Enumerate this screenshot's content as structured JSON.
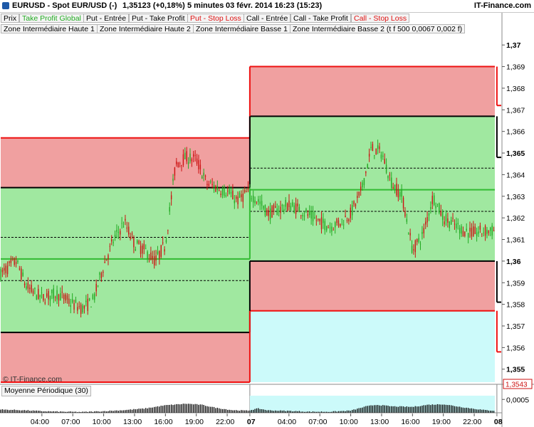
{
  "header": {
    "instrument": "EURUSD - Spot EUR/USD (-)",
    "quote": "1,35123 (+0,18%)",
    "period": "5 minutes",
    "datetime": "03 févr. 2014 16:23 (15:23)",
    "brand": "IT-Finance.com"
  },
  "legend": [
    {
      "label": "Prix",
      "color": "#000000"
    },
    {
      "label": "Take Profit Global",
      "color": "#22aa22"
    },
    {
      "label": "Put - Entrée",
      "color": "#000000"
    },
    {
      "label": "Put - Take Profit",
      "color": "#000000"
    },
    {
      "label": "Put - Stop Loss",
      "color": "#dd1111"
    },
    {
      "label": "Call - Entrée",
      "color": "#000000"
    },
    {
      "label": "Call - Take Profit",
      "color": "#000000"
    },
    {
      "label": "Call - Stop Loss",
      "color": "#dd1111"
    },
    {
      "label": "Zone Intermédiaire Haute 1",
      "color": "#000000"
    },
    {
      "label": "Zone Intermédiaire Haute 2",
      "color": "#000000"
    },
    {
      "label": "Zone Intermédiaire Basse 1",
      "color": "#000000"
    },
    {
      "label": "Zone Intermédiaire Basse 2 (t f 500 0,0067 0,002 f)",
      "color": "#000000"
    }
  ],
  "copyright": "© IT-Finance.com",
  "indicator": {
    "label": "Moyenne Périodique (30)"
  },
  "colors": {
    "candle_up": "#22aa22",
    "candle_down": "#cc1111",
    "zone_red": "#f0a0a0",
    "zone_green": "#a0e8a0",
    "zone_cyan": "#ccfafa",
    "stop_line": "#ee1111",
    "entry_line": "#000000",
    "tp_line": "#33bb33",
    "histogram": "#000000",
    "current_price_box": "#cc1111"
  },
  "chart_data": {
    "type": "line",
    "title": "",
    "xlabel": "",
    "ylabel": "",
    "ylim": [
      1.3543,
      1.3705
    ],
    "y_ticks": [
      "1,37",
      "1,369",
      "1,368",
      "1,367",
      "1,366",
      "1,365",
      "1,364",
      "1,363",
      "1,362",
      "1,361",
      "1,36",
      "1,359",
      "1,358",
      "1,357",
      "1,356",
      "1,355"
    ],
    "y_ticks_bold": [
      "1,37",
      "1,365",
      "1,36",
      "1,355"
    ],
    "y_tick_values": [
      1.37,
      1.369,
      1.368,
      1.367,
      1.366,
      1.365,
      1.364,
      1.363,
      1.362,
      1.361,
      1.36,
      1.359,
      1.358,
      1.357,
      1.356,
      1.355
    ],
    "current_price_label": "1,3543",
    "x_range": [
      0,
      48
    ],
    "x_ticks": [
      {
        "label": "04:00",
        "x": 4
      },
      {
        "label": "07:00",
        "x": 7
      },
      {
        "label": "10:00",
        "x": 10
      },
      {
        "label": "13:00",
        "x": 13
      },
      {
        "label": "16:00",
        "x": 16
      },
      {
        "label": "19:00",
        "x": 19
      },
      {
        "label": "22:00",
        "x": 22
      },
      {
        "label": "07",
        "x": 24.2,
        "bold": true
      },
      {
        "label": "04:00",
        "x": 28
      },
      {
        "label": "07:00",
        "x": 31
      },
      {
        "label": "10:00",
        "x": 34
      },
      {
        "label": "13:00",
        "x": 37
      },
      {
        "label": "16:00",
        "x": 40
      },
      {
        "label": "19:00",
        "x": 43
      },
      {
        "label": "22:00",
        "x": 46
      },
      {
        "label": "08",
        "x": 48.2,
        "bold": true
      }
    ],
    "zones": [
      {
        "x": [
          0,
          24.2
        ],
        "y": [
          1.3657,
          1.3634
        ],
        "color": "red"
      },
      {
        "x": [
          0,
          24.2
        ],
        "y": [
          1.3634,
          1.3567
        ],
        "color": "green"
      },
      {
        "x": [
          0,
          24.2
        ],
        "y": [
          1.3567,
          1.3544
        ],
        "color": "red"
      },
      {
        "x": [
          24.2,
          48.2
        ],
        "y": [
          1.369,
          1.3667
        ],
        "color": "red"
      },
      {
        "x": [
          24.2,
          48.2
        ],
        "y": [
          1.3667,
          1.36
        ],
        "color": "green"
      },
      {
        "x": [
          24.2,
          48.2
        ],
        "y": [
          1.36,
          1.3577
        ],
        "color": "red"
      },
      {
        "x": [
          24.2,
          48.2
        ],
        "y": [
          1.3577,
          1.3544
        ],
        "color": "cyan"
      }
    ],
    "levels": [
      {
        "name": "Call - Stop Loss",
        "x": [
          0,
          24.2
        ],
        "y": 1.3657,
        "style": "stop"
      },
      {
        "name": "Put - Entrée",
        "x": [
          0,
          24.2
        ],
        "y": 1.3634,
        "style": "entry"
      },
      {
        "name": "Take Profit Global",
        "x": [
          0,
          24.2
        ],
        "y": 1.3601,
        "style": "tp"
      },
      {
        "name": "Zone Intermédiaire Haute",
        "x": [
          0,
          24.2
        ],
        "y": 1.3611,
        "style": "dashed"
      },
      {
        "name": "Zone Intermédiaire Basse",
        "x": [
          0,
          24.2
        ],
        "y": 1.3591,
        "style": "dashed"
      },
      {
        "name": "Call - Entrée",
        "x": [
          0,
          24.2
        ],
        "y": 1.3567,
        "style": "entry"
      },
      {
        "name": "Put - Stop Loss",
        "x": [
          0,
          24.2
        ],
        "y": 1.3544,
        "style": "stop"
      },
      {
        "name": "Call - Stop Loss",
        "x": [
          24.2,
          48.2
        ],
        "y": 1.369,
        "style": "stop"
      },
      {
        "name": "Put - Entrée",
        "x": [
          24.2,
          48.2
        ],
        "y": 1.3667,
        "style": "entry"
      },
      {
        "name": "Zone Intermédiaire Haute",
        "x": [
          24.2,
          48.2
        ],
        "y": 1.3643,
        "style": "dashed"
      },
      {
        "name": "Take Profit Global",
        "x": [
          24.2,
          48.2
        ],
        "y": 1.3633,
        "style": "tp"
      },
      {
        "name": "Zone Intermédiaire Basse",
        "x": [
          24.2,
          48.2
        ],
        "y": 1.3623,
        "style": "dashed"
      },
      {
        "name": "Call - Entrée",
        "x": [
          24.2,
          48.2
        ],
        "y": 1.36,
        "style": "entry"
      },
      {
        "name": "Put - Stop Loss",
        "x": [
          24.2,
          48.2
        ],
        "y": 1.3577,
        "style": "stop"
      }
    ],
    "price_anchors": [
      [
        0,
        1.3594
      ],
      [
        1.5,
        1.36
      ],
      [
        2.5,
        1.3588
      ],
      [
        4,
        1.3583
      ],
      [
        5.5,
        1.3585
      ],
      [
        7,
        1.358
      ],
      [
        8,
        1.3578
      ],
      [
        9,
        1.3582
      ],
      [
        10,
        1.3598
      ],
      [
        11,
        1.361
      ],
      [
        12,
        1.3618
      ],
      [
        13,
        1.3608
      ],
      [
        14,
        1.3605
      ],
      [
        15,
        1.36
      ],
      [
        16,
        1.3608
      ],
      [
        17,
        1.3645
      ],
      [
        18,
        1.3648
      ],
      [
        19,
        1.3647
      ],
      [
        20,
        1.3636
      ],
      [
        21,
        1.3634
      ],
      [
        22,
        1.3632
      ],
      [
        23,
        1.3628
      ],
      [
        24,
        1.3632
      ],
      [
        25,
        1.3628
      ],
      [
        26,
        1.3622
      ],
      [
        27,
        1.3624
      ],
      [
        28,
        1.3626
      ],
      [
        29,
        1.3624
      ],
      [
        30,
        1.3621
      ],
      [
        31,
        1.3618
      ],
      [
        32,
        1.3616
      ],
      [
        33,
        1.3618
      ],
      [
        34,
        1.3622
      ],
      [
        35,
        1.3632
      ],
      [
        36,
        1.3652
      ],
      [
        37,
        1.365
      ],
      [
        38,
        1.3636
      ],
      [
        39,
        1.363
      ],
      [
        40,
        1.3605
      ],
      [
        41,
        1.3612
      ],
      [
        42,
        1.363
      ],
      [
        43,
        1.362
      ],
      [
        44,
        1.3617
      ],
      [
        45,
        1.3614
      ],
      [
        46,
        1.3613
      ],
      [
        47,
        1.3614
      ],
      [
        47.9,
        1.3614
      ]
    ],
    "indicator_series": {
      "name": "Moyenne Périodique (30)",
      "y_tick": "0,0005",
      "ylim": [
        0,
        0.0008
      ],
      "anchors": [
        [
          0,
          0.00012
        ],
        [
          2,
          0.0001
        ],
        [
          4,
          6e-05
        ],
        [
          6,
          4e-05
        ],
        [
          8,
          3e-05
        ],
        [
          10,
          6e-05
        ],
        [
          12,
          0.0001
        ],
        [
          14,
          0.00016
        ],
        [
          16,
          0.00028
        ],
        [
          18,
          0.00034
        ],
        [
          19.5,
          0.0003
        ],
        [
          21,
          0.00018
        ],
        [
          22.5,
          0.0001
        ],
        [
          24,
          8e-05
        ],
        [
          25,
          0.00016
        ],
        [
          26,
          9e-05
        ],
        [
          28,
          7e-05
        ],
        [
          30,
          4e-05
        ],
        [
          32,
          4e-05
        ],
        [
          34,
          8e-05
        ],
        [
          35.5,
          0.00024
        ],
        [
          36.5,
          0.0003
        ],
        [
          38,
          0.00024
        ],
        [
          40,
          0.00022
        ],
        [
          41.5,
          0.0003
        ],
        [
          43,
          0.00032
        ],
        [
          45,
          0.0002
        ],
        [
          47,
          0.0001
        ],
        [
          48,
          8e-05
        ]
      ]
    }
  }
}
